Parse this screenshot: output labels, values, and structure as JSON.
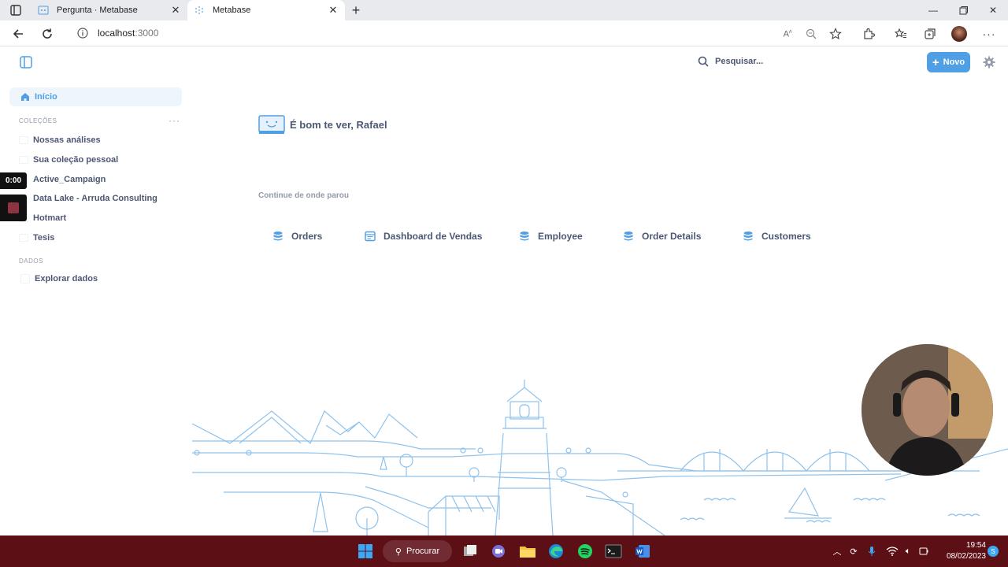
{
  "browser": {
    "tabs": [
      {
        "title": "Pergunta · Metabase",
        "active": false
      },
      {
        "title": "Metabase",
        "active": true
      }
    ],
    "url": {
      "host": "localhost",
      "port": ":3000"
    }
  },
  "recorder": {
    "time": "0:00"
  },
  "sidebar": {
    "home_label": "Início",
    "collections_title": "COLEÇÕES",
    "collections": [
      {
        "label": "Nossas análises"
      },
      {
        "label": "Sua coleção pessoal"
      },
      {
        "label": "Active_Campaign"
      },
      {
        "label": "Data Lake - Arruda Consulting"
      },
      {
        "label": "Hotmart"
      },
      {
        "label": "Tesis"
      }
    ],
    "data_title": "DADOS",
    "data_items": [
      {
        "label": "Explorar dados"
      }
    ]
  },
  "header": {
    "search_placeholder": "Pesquisar...",
    "new_label": "Novo"
  },
  "main": {
    "greeting": "É bom te ver, Rafael",
    "continue_title": "Continue de onde parou",
    "recent": [
      {
        "label": "Orders",
        "icon": "database-icon"
      },
      {
        "label": "Dashboard de Vendas",
        "icon": "dashboard-icon"
      },
      {
        "label": "Employee",
        "icon": "database-icon"
      },
      {
        "label": "Order Details",
        "icon": "database-icon"
      },
      {
        "label": "Customers",
        "icon": "database-icon"
      }
    ]
  },
  "taskbar": {
    "search_label": "Procurar",
    "time": "19:54",
    "date": "08/02/2023"
  },
  "colors": {
    "brand": "#509ee3",
    "text": "#4c5773",
    "muted": "#949aab",
    "taskbar": "#5d0f16"
  }
}
